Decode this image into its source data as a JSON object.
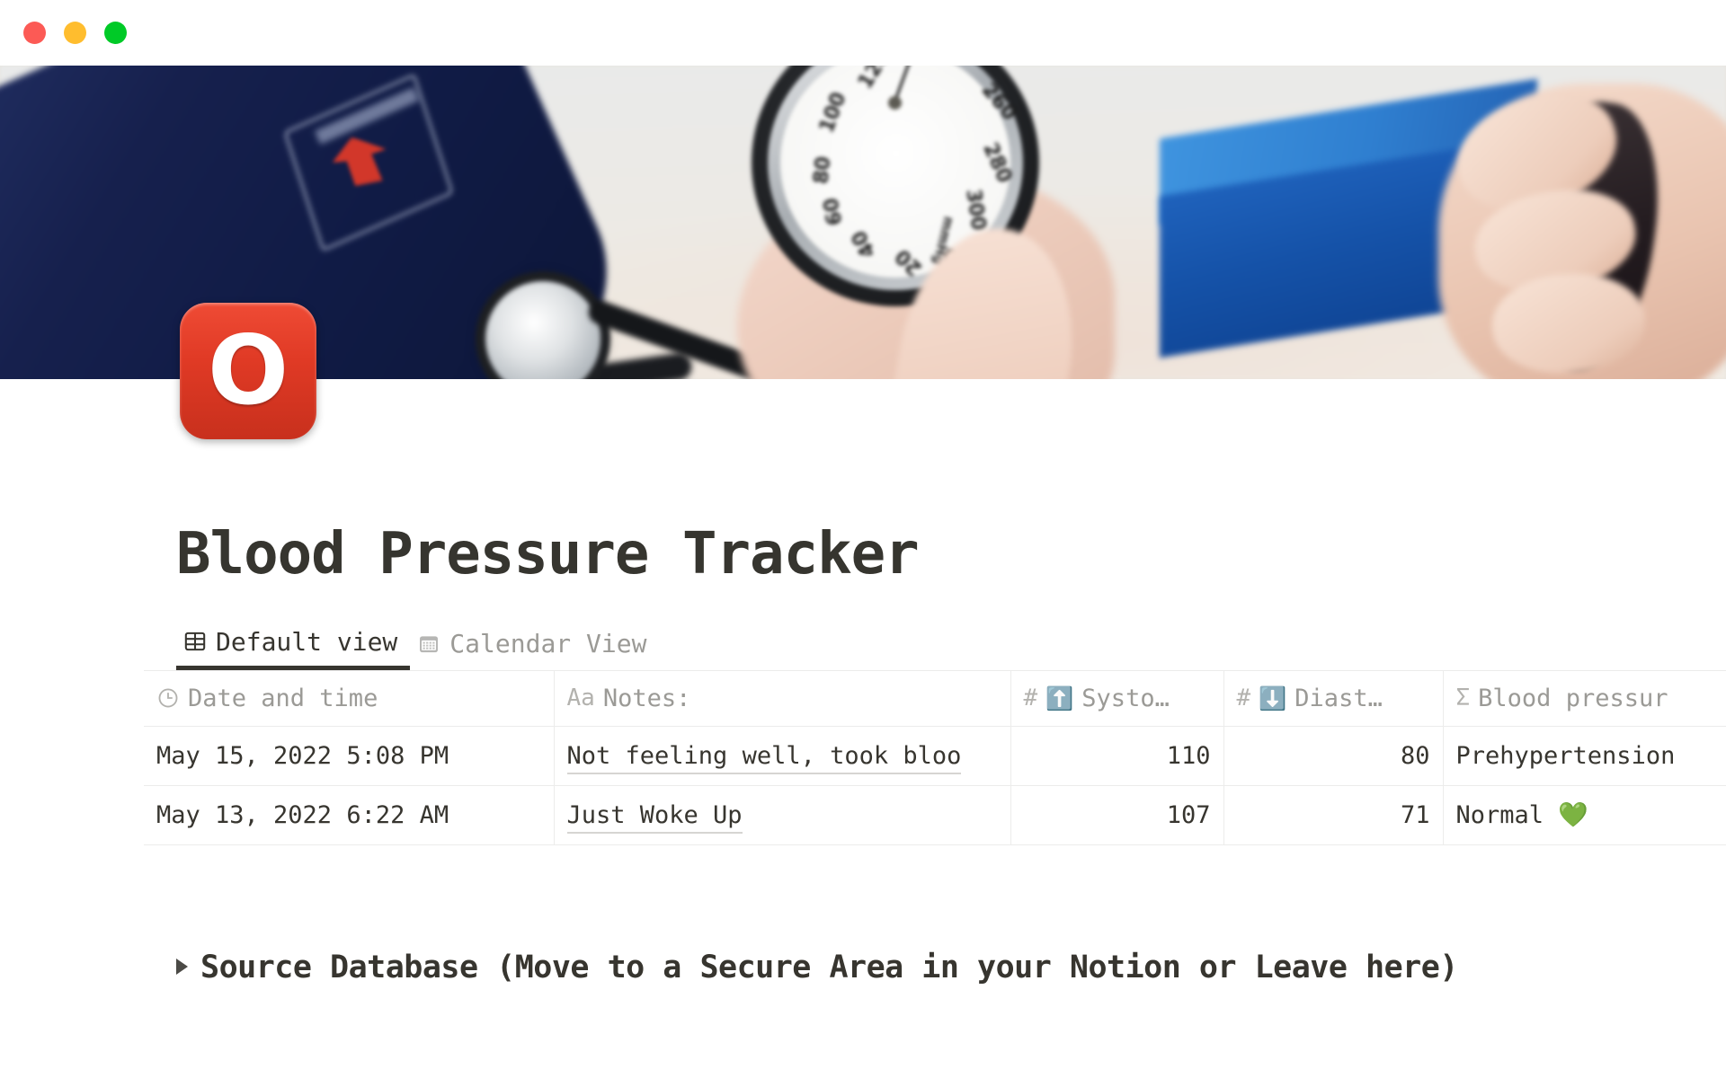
{
  "window": {
    "controls": [
      {
        "name": "close",
        "color": "#fc5a55"
      },
      {
        "name": "minimize",
        "color": "#ffbd2e"
      },
      {
        "name": "maximize",
        "color": "#00ca27"
      }
    ]
  },
  "cover": {
    "description": "Blurred photo of a blood pressure measurement: navy cuff with red arrow, stethoscope, aneroid gauge held in a hand, blue box, hand squeezing black bulb",
    "gauge_ticks": [
      "100",
      "80",
      "60",
      "40",
      "20",
      "260",
      "280",
      "300",
      "mmHg"
    ]
  },
  "page": {
    "icon": "O",
    "icon_name": "o-button-emoji",
    "icon_color": "#e03a25",
    "title": "Blood Pressure Tracker"
  },
  "views": {
    "tabs": [
      {
        "label": "Default view",
        "icon": "table-icon",
        "active": true
      },
      {
        "label": "Calendar View",
        "icon": "calendar-icon",
        "active": false
      }
    ]
  },
  "table": {
    "columns": [
      {
        "key": "date",
        "prop_icon": "clock-icon",
        "emoji": "",
        "label": "Date and time",
        "align": "left"
      },
      {
        "key": "notes",
        "prop_icon": "Aa",
        "emoji": "",
        "label": "Notes:",
        "align": "left"
      },
      {
        "key": "sys",
        "prop_icon": "#",
        "emoji": "⬆️",
        "label": "Systo…",
        "align": "right"
      },
      {
        "key": "dia",
        "prop_icon": "#",
        "emoji": "⬇️",
        "label": "Diast…",
        "align": "right"
      },
      {
        "key": "bp",
        "prop_icon": "Σ",
        "emoji": "",
        "label": "Blood pressur",
        "align": "left"
      }
    ],
    "rows": [
      {
        "date": "May 15, 2022 5:08 PM",
        "notes": "Not feeling well, took bloo",
        "sys": "110",
        "dia": "80",
        "bp": "Prehypertension"
      },
      {
        "date": "May 13, 2022 6:22 AM",
        "notes": "Just Woke Up",
        "sys": "107",
        "dia": "71",
        "bp": "Normal 💚"
      }
    ]
  },
  "toggle": {
    "label": "Source Database (Move to a Secure Area in your Notion or Leave here)"
  }
}
